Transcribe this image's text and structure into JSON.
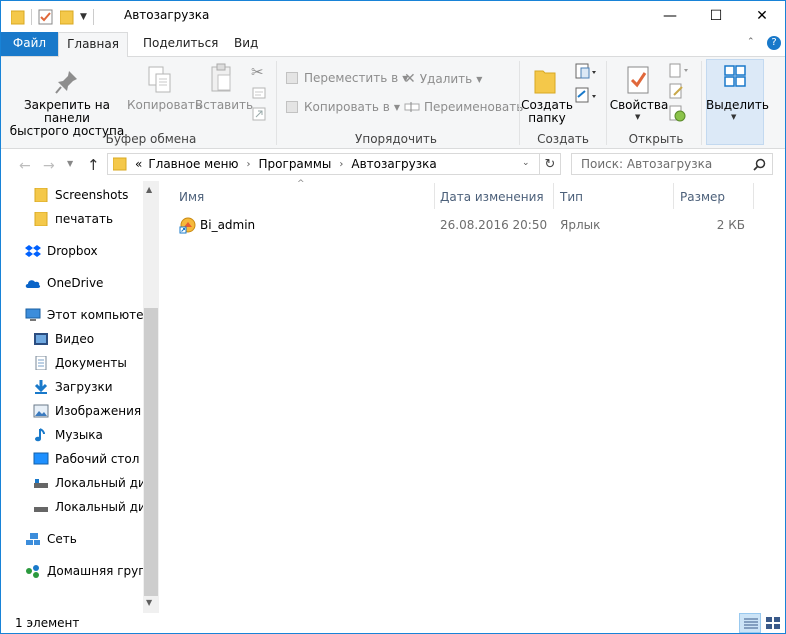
{
  "window": {
    "title": "Автозагрузка",
    "controls": {
      "minimize": "—",
      "maximize": "☐",
      "close": "✕"
    }
  },
  "ribbon_tabs": [
    {
      "label": "Файл"
    },
    {
      "label": "Главная"
    },
    {
      "label": "Поделиться"
    },
    {
      "label": "Вид"
    }
  ],
  "ribbon": {
    "clipboard": {
      "label": "Буфер обмена",
      "pin_line1": "Закрепить на панели",
      "pin_line2": "быстрого доступа",
      "copy": "Копировать",
      "paste": "Вставить"
    },
    "organize": {
      "label": "Упорядочить",
      "move_to": "Переместить в",
      "copy_to": "Копировать в",
      "delete": "Удалить",
      "rename": "Переименовать"
    },
    "new": {
      "label": "Создать",
      "new_folder_line1": "Создать",
      "new_folder_line2": "папку"
    },
    "open": {
      "label": "Открыть",
      "properties": "Свойства"
    },
    "select": {
      "label": "Выделить"
    }
  },
  "address": {
    "overflow": "«",
    "crumbs": [
      "Главное меню",
      "Программы",
      "Автозагрузка"
    ],
    "search_placeholder": "Поиск: Автозагрузка"
  },
  "nav": {
    "items": [
      {
        "label": "Screenshots",
        "icon": "folder-icon"
      },
      {
        "label": "печатать",
        "icon": "folder-icon"
      },
      {
        "label": "Dropbox",
        "icon": "dropbox-icon"
      },
      {
        "label": "OneDrive",
        "icon": "onedrive-icon"
      },
      {
        "label": "Этот компьютер",
        "icon": "computer-icon"
      },
      {
        "label": "Видео",
        "icon": "video-icon"
      },
      {
        "label": "Документы",
        "icon": "documents-icon"
      },
      {
        "label": "Загрузки",
        "icon": "downloads-icon"
      },
      {
        "label": "Изображения",
        "icon": "pictures-icon"
      },
      {
        "label": "Музыка",
        "icon": "music-icon"
      },
      {
        "label": "Рабочий стол",
        "icon": "desktop-icon"
      },
      {
        "label": "Локальный дис",
        "icon": "drive-icon"
      },
      {
        "label": "Локальный дис",
        "icon": "drive-icon"
      },
      {
        "label": "Сеть",
        "icon": "network-icon"
      },
      {
        "label": "Домашняя групп",
        "icon": "homegroup-icon"
      }
    ]
  },
  "columns": {
    "name": "Имя",
    "date": "Дата изменения",
    "type": "Тип",
    "size": "Размер"
  },
  "files": [
    {
      "name": "Bi_admin",
      "date": "26.08.2016 20:50",
      "type": "Ярлык",
      "size": "2 КБ"
    }
  ],
  "status": {
    "count": "1 элемент"
  },
  "colors": {
    "accent": "#1979ca",
    "folder": "#f4c84a",
    "header_text": "#4c607a",
    "disabled_text": "#8d8d8d"
  }
}
